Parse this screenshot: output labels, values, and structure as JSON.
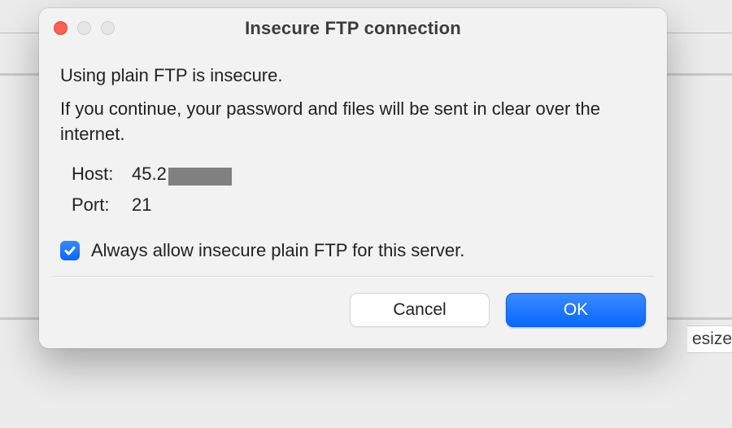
{
  "background": {
    "filesize_label_fragment": "esize"
  },
  "dialog": {
    "title": "Insecure FTP connection",
    "message1": "Using plain FTP is insecure.",
    "message2": "If you continue, your password and files will be sent in clear over the internet.",
    "host_label": "Host:",
    "host_value_visible": "45.2",
    "port_label": "Port:",
    "port_value": "21",
    "checkbox_label": "Always allow insecure plain FTP for this server.",
    "checkbox_checked": true,
    "cancel_label": "Cancel",
    "ok_label": "OK"
  }
}
